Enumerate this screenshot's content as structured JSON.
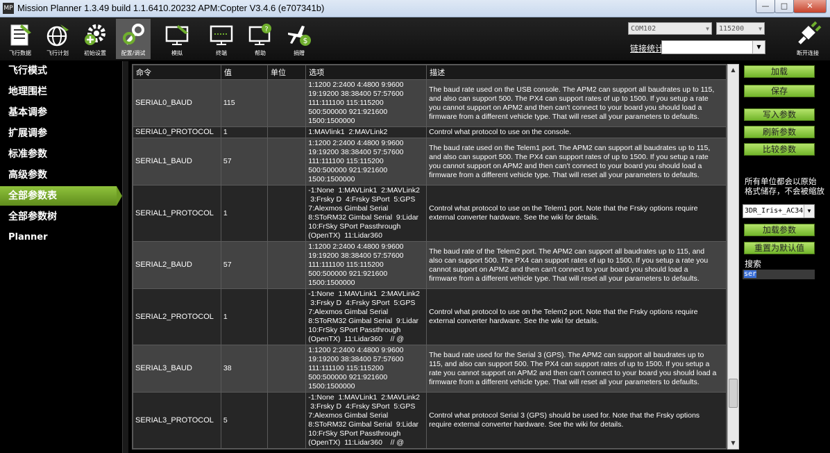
{
  "window": {
    "title": "Mission Planner 1.3.49 build 1.1.6410.20232 APM:Copter V3.4.6 (e707341b)",
    "icon_text": "MP",
    "minimize": "—",
    "maximize": "□",
    "close": "✕"
  },
  "toolbar": {
    "items": [
      {
        "label": "飞行数据",
        "icon": "flight-data-icon"
      },
      {
        "label": "飞行计划",
        "icon": "flight-plan-icon"
      },
      {
        "label": "初始设置",
        "icon": "initial-setup-icon"
      },
      {
        "label": "配置/调试",
        "icon": "config-tuning-icon"
      },
      {
        "label": "模拟",
        "icon": "simulation-icon"
      },
      {
        "label": "终端",
        "icon": "terminal-icon"
      },
      {
        "label": "帮助",
        "icon": "help-icon"
      },
      {
        "label": "捐赠",
        "icon": "donate-icon"
      }
    ],
    "port": "COM102",
    "baud": "115200",
    "stats_link": "链接统计",
    "disconnect_label": "断开连接"
  },
  "sidebar": {
    "items": [
      {
        "label": "飞行模式"
      },
      {
        "label": "地理围栏"
      },
      {
        "label": "基本调参"
      },
      {
        "label": "扩展调参"
      },
      {
        "label": "标准参数"
      },
      {
        "label": "高级参数"
      },
      {
        "label": "全部参数表"
      },
      {
        "label": "全部参数树"
      },
      {
        "label": "Planner"
      }
    ],
    "active_index": 6
  },
  "table": {
    "columns": [
      "命令",
      "值",
      "单位",
      "选项",
      "描述"
    ],
    "rows": [
      {
        "name": "SERIAL0_BAUD",
        "value": "115",
        "unit": "",
        "options": [
          "1:1200 2:2400 4:4800 9:9600",
          "19:19200 38:38400 57:57600",
          "111:111100 115:115200",
          "500:500000 921:921600",
          "1500:1500000"
        ],
        "desc": [
          "The baud rate used on the USB console. The APM2 can support all baudrates up to 115,",
          "and also can support 500. The PX4 can support rates of up to 1500. If you setup a rate",
          "you cannot support on APM2 and then can't connect to your board you should load a",
          "firmware from a different vehicle type. That will reset all your parameters to defaults."
        ]
      },
      {
        "name": "SERIAL0_PROTOCOL",
        "value": "1",
        "unit": "",
        "options": [
          "1:MAVlink1  2:MAVLink2"
        ],
        "desc": [
          "Control what protocol to use on the console."
        ]
      },
      {
        "name": "SERIAL1_BAUD",
        "value": "57",
        "unit": "",
        "options": [
          "1:1200 2:2400 4:4800 9:9600",
          "19:19200 38:38400 57:57600",
          "111:111100 115:115200",
          "500:500000 921:921600",
          "1500:1500000"
        ],
        "desc": [
          "The baud rate used on the Telem1 port. The APM2 can support all baudrates up to 115,",
          "and also can support 500. The PX4 can support rates of up to 1500. If you setup a rate",
          "you cannot support on APM2 and then can't connect to your board you should load a",
          "firmware from a different vehicle type. That will reset all your parameters to defaults."
        ]
      },
      {
        "name": "SERIAL1_PROTOCOL",
        "value": "1",
        "unit": "",
        "options": [
          "-1:None  1:MAVLink1  2:MAVLink2",
          " 3:Frsky D  4:Frsky SPort  5:GPS",
          "7:Alexmos Gimbal Serial",
          "8:SToRM32 Gimbal Serial  9:Lidar",
          "10:FrSky SPort Passthrough",
          "(OpenTX)  11:Lidar360"
        ],
        "desc": [
          "Control what protocol to use on the Telem1 port. Note that the Frsky options require",
          "external converter hardware. See the wiki for details."
        ]
      },
      {
        "name": "SERIAL2_BAUD",
        "value": "57",
        "unit": "",
        "options": [
          "1:1200 2:2400 4:4800 9:9600",
          "19:19200 38:38400 57:57600",
          "111:111100 115:115200",
          "500:500000 921:921600",
          "1500:1500000"
        ],
        "desc": [
          "The baud rate of the Telem2 port. The APM2 can support all baudrates up to 115, and",
          "also can support 500. The PX4 can support rates of up to 1500. If you setup a rate you",
          "cannot support on APM2 and then can't connect to your board you should load a",
          "firmware from a different vehicle type. That will reset all your parameters to defaults."
        ]
      },
      {
        "name": "SERIAL2_PROTOCOL",
        "value": "1",
        "unit": "",
        "options": [
          "-1:None  1:MAVLink1  2:MAVLink2",
          " 3:Frsky D  4:Frsky SPort  5:GPS",
          "7:Alexmos Gimbal Serial",
          "8:SToRM32 Gimbal Serial  9:Lidar",
          "10:FrSky SPort Passthrough",
          "(OpenTX)  11:Lidar360    // @"
        ],
        "desc": [
          "Control what protocol to use on the Telem2 port. Note that the Frsky options require",
          "external converter hardware. See the wiki for details."
        ]
      },
      {
        "name": "SERIAL3_BAUD",
        "value": "38",
        "unit": "",
        "options": [
          "1:1200 2:2400 4:4800 9:9600",
          "19:19200 38:38400 57:57600",
          "111:111100 115:115200",
          "500:500000 921:921600",
          "1500:1500000"
        ],
        "desc": [
          "The baud rate used for the Serial 3 (GPS). The APM2 can support all baudrates up to",
          "115, and also can support 500. The PX4 can support rates of up to 1500. If you setup a",
          "rate you cannot support on APM2 and then can't connect to your board you should load a",
          "firmware from a different vehicle type. That will reset all your parameters to defaults."
        ]
      },
      {
        "name": "SERIAL3_PROTOCOL",
        "value": "5",
        "unit": "",
        "options": [
          "-1:None  1:MAVLink1  2:MAVLink2",
          " 3:Frsky D  4:Frsky SPort  5:GPS",
          "7:Alexmos Gimbal Serial",
          "8:SToRM32 Gimbal Serial  9:Lidar",
          "10:FrSky SPort Passthrough",
          "(OpenTX)  11:Lidar360    // @"
        ],
        "desc": [
          "Control what protocol Serial 3 (GPS) should be used for. Note that the Frsky options",
          "require external converter hardware. See the wiki for details."
        ]
      }
    ]
  },
  "right_panel": {
    "load_button": "加载",
    "save_button": "保存",
    "write_button": "写入参数",
    "refresh_button": "刷新参数",
    "compare_button": "比较参数",
    "note_line1": "所有单位都会以原始",
    "note_line2": "格式储存，不会被缩放",
    "param_file": "3DR_Iris+_AC34",
    "load_params_button": "加载参数",
    "reset_default_button": "重置为默认值",
    "search_label": "搜索",
    "search_value": "ser"
  },
  "colors": {
    "accent_green": "#8fc23c",
    "row_light": "#434343",
    "row_dark": "#262626"
  }
}
